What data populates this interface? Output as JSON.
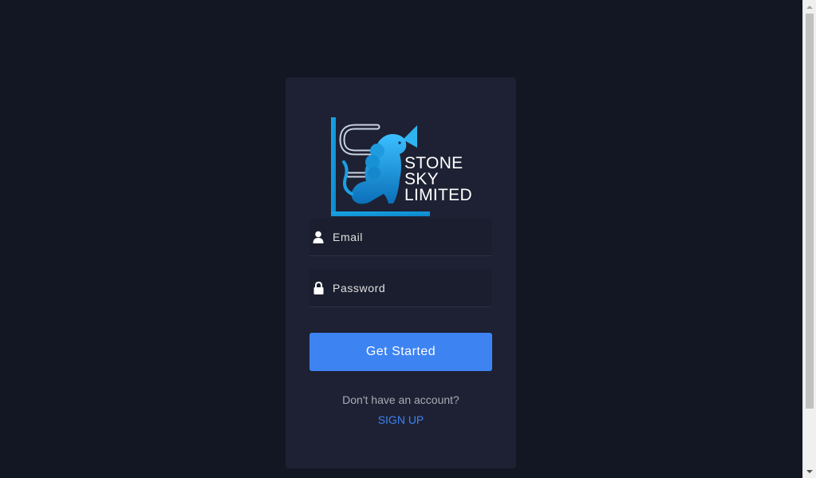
{
  "brand": {
    "logo_lines": [
      "STONE",
      "SKY",
      "LIMITED"
    ],
    "logo_accent_color": "#1fa3e8",
    "logo_dark_color": "#0a7fc4"
  },
  "login_form": {
    "email": {
      "placeholder": "Email",
      "value": "",
      "icon": "user-icon"
    },
    "password": {
      "placeholder": "Password",
      "value": "",
      "icon": "lock-icon"
    },
    "submit_label": "Get Started",
    "signup_prompt": "Don't have an account?",
    "signup_link": "SIGN UP"
  },
  "colors": {
    "page_background": "#131723",
    "card_background": "#1e2133",
    "primary": "#3d83f2",
    "muted_text": "#a9acb6"
  }
}
